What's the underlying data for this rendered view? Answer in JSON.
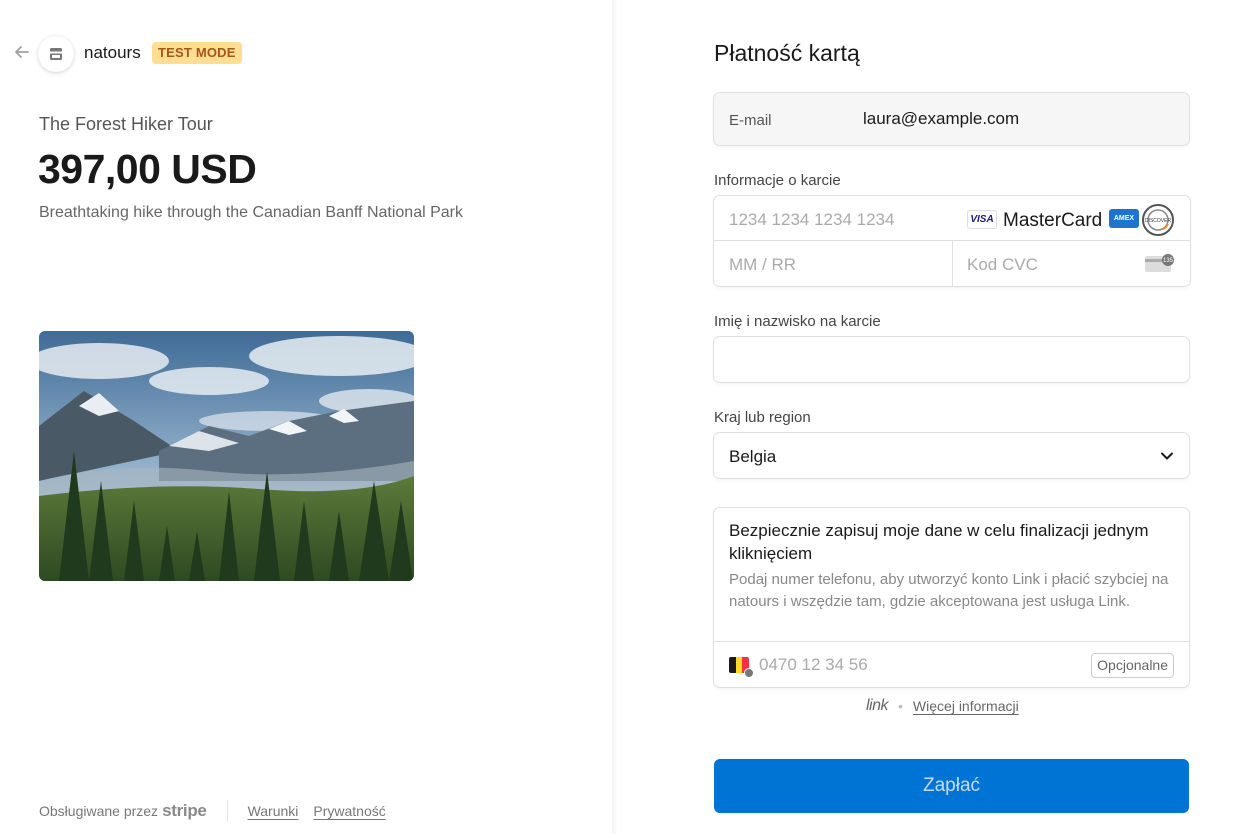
{
  "merchant": {
    "name": "natours",
    "badge": "TEST MODE"
  },
  "product": {
    "name": "The Forest Hiker Tour",
    "price": "397,00 USD",
    "description": "Breathtaking hike through the Canadian Banff National Park"
  },
  "footer": {
    "powered_by": "Obsługiwane przez",
    "stripe": "stripe",
    "terms": "Warunki",
    "privacy": "Prywatność"
  },
  "checkout": {
    "title": "Płatność kartą",
    "email_label": "E-mail",
    "email_value": "laura@example.com",
    "card_label": "Informacje o karcie",
    "card_number_placeholder": "1234 1234 1234 1234",
    "expiry_placeholder": "MM / RR",
    "cvc_placeholder": "Kod CVC",
    "brands": {
      "visa": "VISA",
      "mastercard": "MasterCard",
      "amex": "AMEX",
      "discover": "DISCOVER"
    },
    "cvc_icon_text": "135",
    "name_label": "Imię i nazwisko na karcie",
    "name_value": "",
    "country_label": "Kraj lub region",
    "country_value": "Belgia",
    "link": {
      "title": "Bezpiecznie zapisuj moje dane w celu finalizacji jednym kliknięciem",
      "description": "Podaj numer telefonu, aby utworzyć konto Link i płacić szybciej na natours i wszędzie tam, gdzie akceptowana jest usługa Link.",
      "phone_placeholder": "0470 12 34 56",
      "optional": "Opcjonalne",
      "logo": "link",
      "more_info": "Więcej informacji"
    },
    "pay_button": "Zapłać"
  },
  "colors": {
    "accent": "#0074d4",
    "badge_bg": "#ffde92",
    "badge_text": "#a4561a"
  }
}
